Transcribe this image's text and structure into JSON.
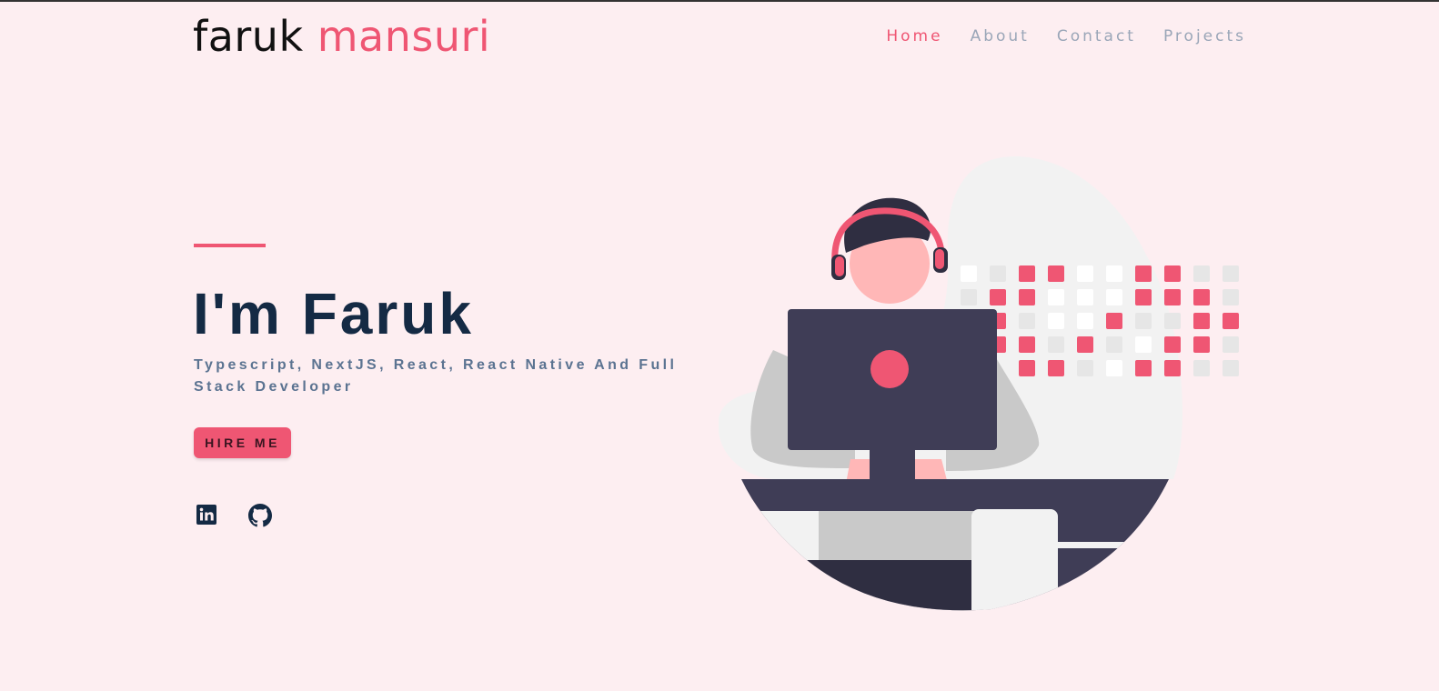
{
  "header": {
    "logo_first": "faruk",
    "logo_last": "mansuri",
    "nav": [
      {
        "label": "Home",
        "active": true
      },
      {
        "label": "About",
        "active": false
      },
      {
        "label": "Contact",
        "active": false
      },
      {
        "label": "Projects",
        "active": false
      }
    ]
  },
  "hero": {
    "headline": "I'm Faruk",
    "subtitle": "Typescript, NextJS, React, React Native And Full Stack Developer",
    "cta_label": "HIRE ME"
  },
  "social": [
    {
      "icon": "linkedin-icon"
    },
    {
      "icon": "github-icon"
    }
  ],
  "colors": {
    "background": "#fdeef1",
    "accent": "#ef5673",
    "heading": "#142a44",
    "subtitle": "#5b7391",
    "nav": "#9aa6b8"
  }
}
